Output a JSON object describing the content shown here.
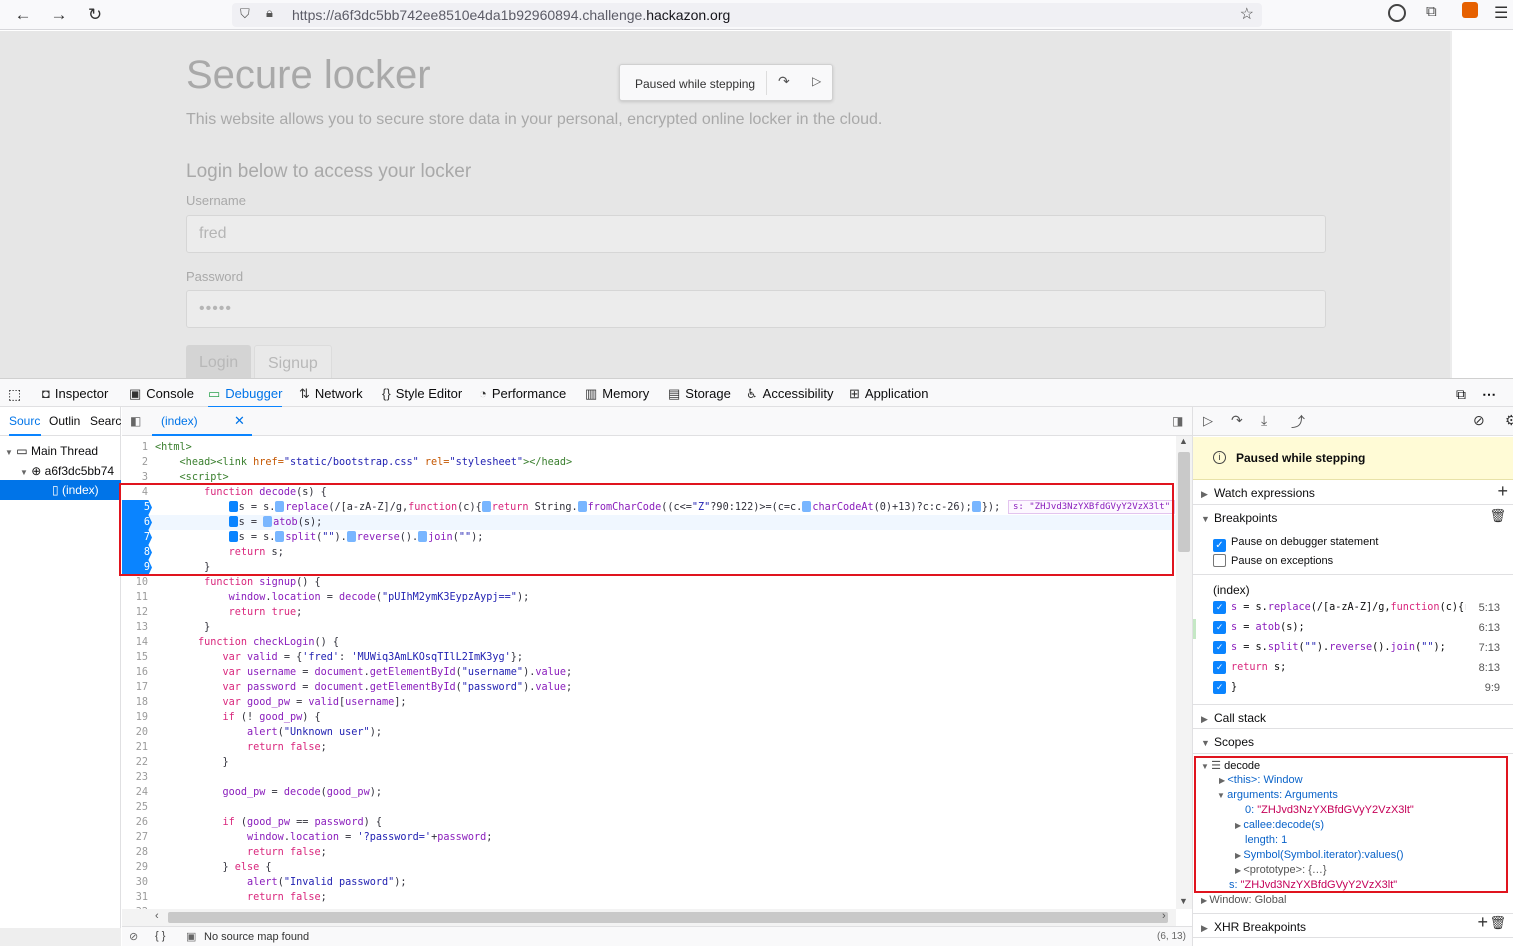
{
  "browser": {
    "url_prefix": "https://a6f3dc5bb742ee8510e4da1b92960894.challenge.",
    "url_host": "hackazon.org"
  },
  "page": {
    "title": "Secure locker",
    "subtitle": "This website allows you to secure store data in your personal, encrypted online locker in the cloud.",
    "login_heading": "Login below to access your locker",
    "username_label": "Username",
    "username_value": "fred",
    "password_label": "Password",
    "password_value": "•••••",
    "login_tab": "Login",
    "signup_tab": "Signup",
    "paused_overlay": "Paused while stepping"
  },
  "devtools": {
    "tabs": [
      "Inspector",
      "Console",
      "Debugger",
      "Network",
      "Style Editor",
      "Performance",
      "Memory",
      "Storage",
      "Accessibility",
      "Application"
    ],
    "sources_tabs": [
      "Sourc",
      "Outlin",
      "Searcl"
    ],
    "tree": {
      "thread": "Main Thread",
      "domain": "a6f3dc5bb74",
      "file": "(index)"
    },
    "editor_tab": "(index)",
    "inline_preview": "s: \"ZHJvd3NzYXBfdGVyY2VzX3lt\"",
    "status": {
      "source_map": "No source map found",
      "cursor": "(6, 13)",
      "pretty": "{ }"
    }
  },
  "right": {
    "paused_banner": "Paused while stepping",
    "watch": "Watch expressions",
    "breakpoints": "Breakpoints",
    "pause_debugger": "Pause on debugger statement",
    "pause_exceptions": "Pause on exceptions",
    "bp_file": "(index)",
    "bp_items": [
      {
        "text": "s = s.replace(/[a-zA-Z]/g,function(c){r…",
        "pos": "5:13"
      },
      {
        "text": "s = atob(s);",
        "pos": "6:13"
      },
      {
        "text": "s = s.split(\"\").reverse().join(\"\");",
        "pos": "7:13"
      },
      {
        "text": "return s;",
        "pos": "8:13"
      },
      {
        "text": "}",
        "pos": "9:9"
      }
    ],
    "call_stack": "Call stack",
    "scopes": "Scopes",
    "scope_rows": {
      "decode": "decode",
      "this_key": "<this>:",
      "this_val": "Window",
      "args_key": "arguments:",
      "args_val": "Arguments",
      "arg0_key": "0:",
      "arg0_val": "\"ZHJvd3NzYXBfdGVyY2VzX3lt\"",
      "callee": "callee:decode(s)",
      "length": "length: 1",
      "symbol": "Symbol(Symbol.iterator):values()",
      "proto": "<prototype>: {…}",
      "s_key": "s:",
      "s_val": "\"ZHJvd3NzYXBfdGVyY2VzX3lt\""
    },
    "window_global": "Window: Global",
    "xhr": "XHR Breakpoints"
  }
}
